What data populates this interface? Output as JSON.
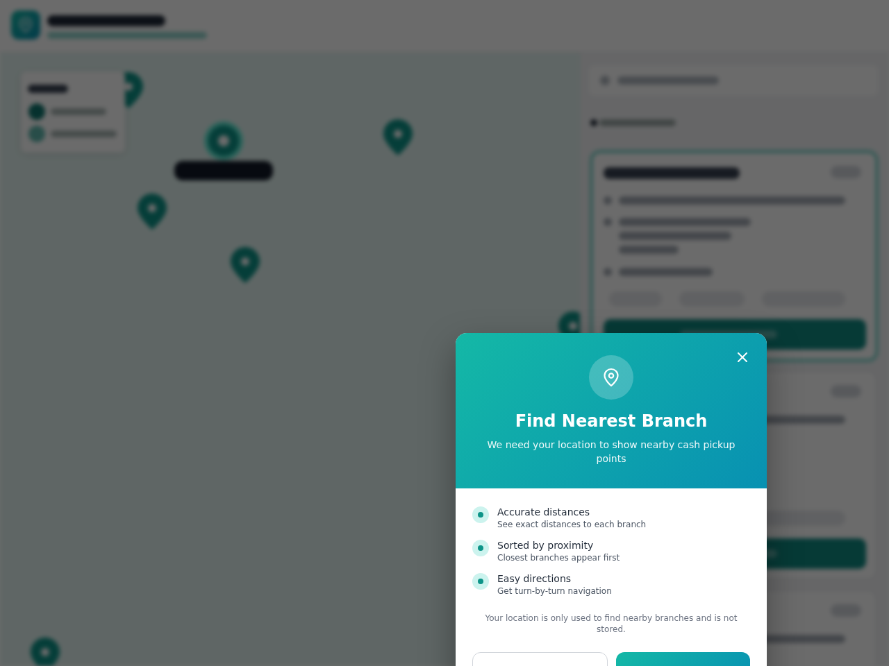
{
  "background": {
    "blurred": true
  },
  "map": {
    "pins": [
      {
        "selected": false
      },
      {
        "selected": true
      },
      {
        "selected": false
      },
      {
        "selected": false
      },
      {
        "selected": false
      },
      {
        "selected": false
      },
      {
        "selected": false
      }
    ]
  },
  "side_panel": {
    "cards": [
      {
        "selected": true
      },
      {
        "selected": false
      },
      {
        "selected": false
      }
    ]
  },
  "dialog": {
    "title": "Find Nearest Branch",
    "subtitle": "We need your location to show nearby cash pickup points",
    "features": [
      {
        "title": "Accurate distances",
        "description": "See exact distances to each branch"
      },
      {
        "title": "Sorted by proximity",
        "description": "Closest branches appear first"
      },
      {
        "title": "Easy directions",
        "description": "Get turn-by-turn navigation"
      }
    ],
    "privacy_note": "Your location is only used to find nearby branches and is not stored.",
    "buttons": [
      {
        "kind": "secondary"
      },
      {
        "kind": "primary"
      }
    ]
  }
}
